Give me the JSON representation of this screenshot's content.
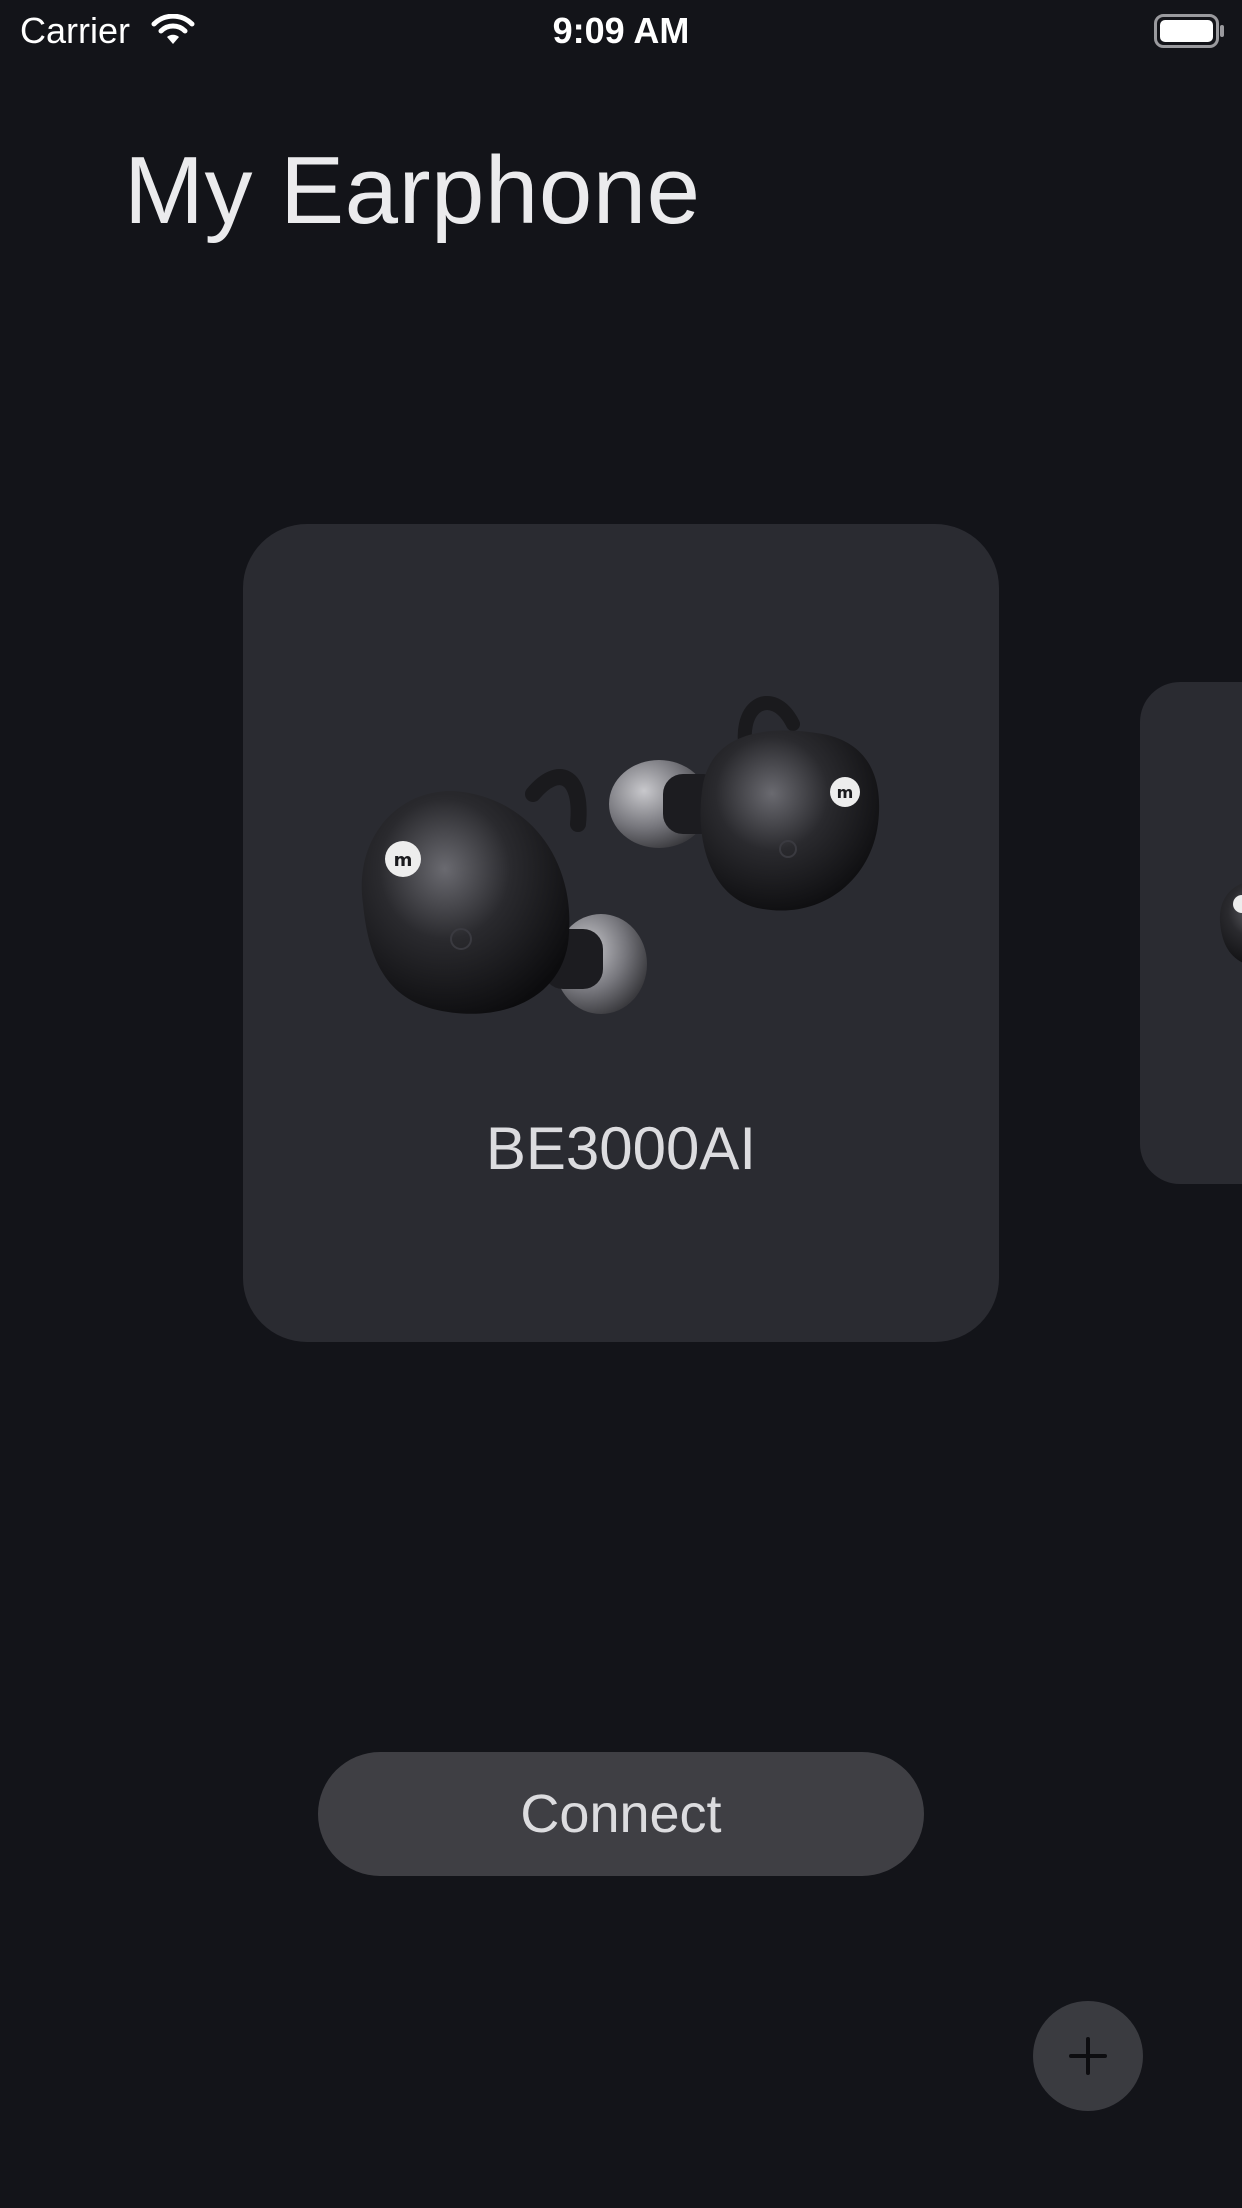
{
  "status_bar": {
    "carrier": "Carrier",
    "time": "9:09 AM",
    "wifi_icon": "wifi-icon",
    "battery_icon": "battery-icon"
  },
  "header": {
    "title": "My Earphone"
  },
  "devices": [
    {
      "name": "BE3000AI",
      "image_icon": "earphones-image"
    }
  ],
  "actions": {
    "connect_label": "Connect",
    "add_icon": "plus-icon"
  },
  "colors": {
    "background": "#131419",
    "card": "#2a2b31",
    "button": "#3f3f44",
    "fab": "#3a3b40",
    "text": "#e6e6e8"
  }
}
